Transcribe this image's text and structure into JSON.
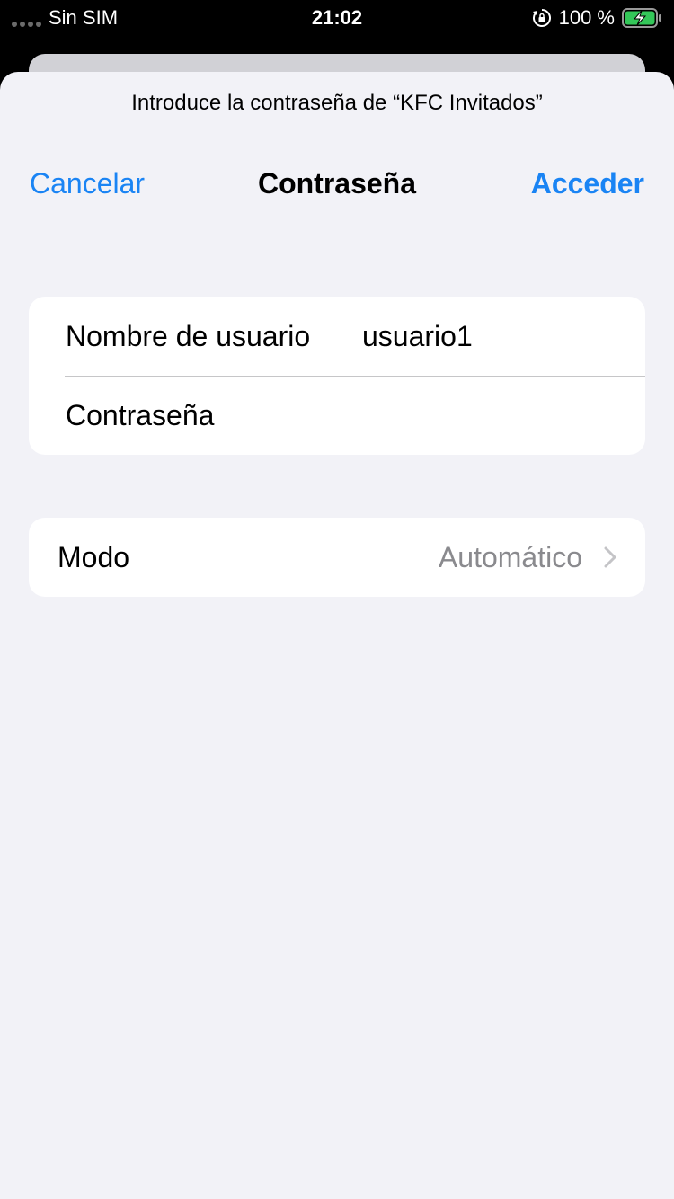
{
  "status_bar": {
    "carrier": "Sin SIM",
    "time": "21:02",
    "battery_percent": "100 %",
    "battery_level": 1.0,
    "charging": true,
    "icons": [
      "signal-dots-icon",
      "orientation-lock-icon",
      "battery-charging-icon"
    ]
  },
  "sheet": {
    "prompt": "Introduce la contraseña de “KFC Invitados”",
    "nav": {
      "cancel_label": "Cancelar",
      "title": "Contraseña",
      "join_label": "Acceder"
    },
    "credentials": {
      "username_label": "Nombre de usuario",
      "username_value": "usuario1",
      "password_label": "Contraseña",
      "password_value": ""
    },
    "mode": {
      "label": "Modo",
      "value": "Automático"
    }
  },
  "colors": {
    "accent": "#1a84f4",
    "background": "#f2f2f7",
    "card": "#ffffff",
    "secondary_text": "#8a8a8e",
    "battery_fill": "#34c759"
  }
}
